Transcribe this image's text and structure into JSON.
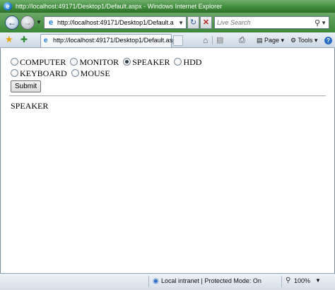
{
  "window": {
    "title": "http://localhost:49171/Desktop1/Default.aspx - Windows Internet Explorer"
  },
  "toolbar": {
    "address": "http://localhost:49171/Desktop1/Default.aspx",
    "search_placeholder": "Live Search"
  },
  "tab": {
    "label": "http://localhost:49171/Desktop1/Default.aspx"
  },
  "commands": {
    "page": "Page",
    "tools": "Tools"
  },
  "form": {
    "options": [
      {
        "label": "COMPUTER",
        "checked": false
      },
      {
        "label": "MONITOR",
        "checked": false
      },
      {
        "label": "SPEAKER",
        "checked": true
      },
      {
        "label": "HDD",
        "checked": false
      },
      {
        "label": "KEYBOARD",
        "checked": false
      },
      {
        "label": "MOUSE",
        "checked": false
      }
    ],
    "submit_label": "Submit",
    "result": "SPEAKER"
  },
  "status": {
    "zone": "Local intranet | Protected Mode: On",
    "zoom": "100%"
  }
}
